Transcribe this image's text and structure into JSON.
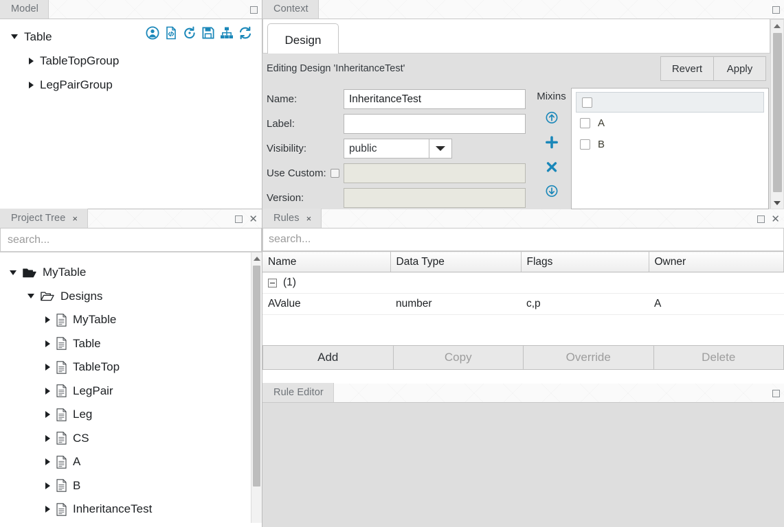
{
  "model_panel": {
    "tab_label": "Model",
    "toolbar_icons": [
      {
        "name": "user-icon"
      },
      {
        "name": "code-document-icon"
      },
      {
        "name": "history-icon"
      },
      {
        "name": "save-icon"
      },
      {
        "name": "hierarchy-icon"
      },
      {
        "name": "refresh-icon"
      }
    ],
    "tree": [
      {
        "label": "Table",
        "depth": 0,
        "expanded": true
      },
      {
        "label": "TableTopGroup",
        "depth": 1,
        "expanded": false
      },
      {
        "label": "LegPairGroup",
        "depth": 1,
        "expanded": false
      }
    ]
  },
  "project_tree": {
    "tab_label": "Project Tree",
    "tab_close": "×",
    "search_placeholder": "search...",
    "nodes": [
      {
        "label": "MyTable",
        "depth": 0,
        "expanded": true,
        "icon": "folder-open-filled-icon"
      },
      {
        "label": "Designs",
        "depth": 1,
        "expanded": true,
        "icon": "folder-open-icon"
      },
      {
        "label": "MyTable",
        "depth": 2,
        "expanded": false,
        "icon": "document-icon"
      },
      {
        "label": "Table",
        "depth": 2,
        "expanded": false,
        "icon": "document-icon"
      },
      {
        "label": "TableTop",
        "depth": 2,
        "expanded": false,
        "icon": "document-icon"
      },
      {
        "label": "LegPair",
        "depth": 2,
        "expanded": false,
        "icon": "document-icon"
      },
      {
        "label": "Leg",
        "depth": 2,
        "expanded": false,
        "icon": "document-icon"
      },
      {
        "label": "CS",
        "depth": 2,
        "expanded": false,
        "icon": "document-icon"
      },
      {
        "label": "A",
        "depth": 2,
        "expanded": false,
        "icon": "document-icon"
      },
      {
        "label": "B",
        "depth": 2,
        "expanded": false,
        "icon": "document-icon"
      },
      {
        "label": "InheritanceTest",
        "depth": 2,
        "expanded": false,
        "icon": "document-icon"
      }
    ]
  },
  "context": {
    "tab_label": "Context",
    "design_tab_label": "Design",
    "editing_text": "Editing Design 'InheritanceTest'",
    "revert_label": "Revert",
    "apply_label": "Apply",
    "form": {
      "name_label": "Name:",
      "name_value": "InheritanceTest",
      "label_label": "Label:",
      "label_value": "",
      "visibility_label": "Visibility:",
      "visibility_value": "public",
      "use_custom_label": "Use Custom:",
      "use_custom_checked": false,
      "use_custom_value": "",
      "version_label": "Version:",
      "version_value": ""
    },
    "mixins": {
      "title": "Mixins",
      "actions": [
        {
          "name": "move-up-icon"
        },
        {
          "name": "add-icon"
        },
        {
          "name": "remove-icon"
        },
        {
          "name": "move-down-icon"
        }
      ],
      "items": [
        {
          "label": "A",
          "checked": false
        },
        {
          "label": "B",
          "checked": false
        }
      ]
    }
  },
  "rules": {
    "tab_label": "Rules",
    "tab_close": "×",
    "search_placeholder": "search...",
    "columns": [
      "Name",
      "Data Type",
      "Flags",
      "Owner"
    ],
    "group_row": {
      "label": "(1)",
      "expanded": true
    },
    "rows": [
      {
        "name": "AValue",
        "data_type": "number",
        "flags": "c,p",
        "owner": "A"
      }
    ],
    "buttons": [
      {
        "label": "Add",
        "enabled": true
      },
      {
        "label": "Copy",
        "enabled": false
      },
      {
        "label": "Override",
        "enabled": false
      },
      {
        "label": "Delete",
        "enabled": false
      }
    ]
  },
  "rule_editor": {
    "tab_label": "Rule Editor"
  },
  "colors": {
    "accent": "#1a87b9",
    "panel_bg": "#e0e0e0",
    "tab_bg": "#e3e3e3",
    "disabled_text": "#9d9d9d"
  }
}
